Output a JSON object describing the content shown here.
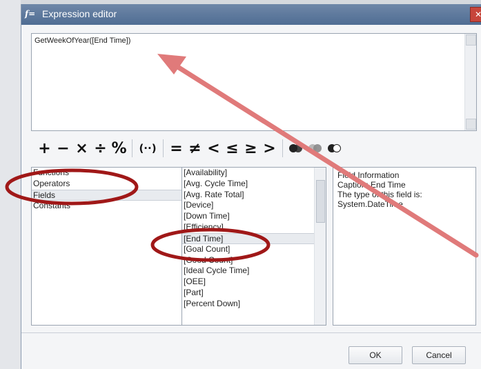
{
  "window": {
    "title": "Expression editor",
    "title_icon_glyph": "f=",
    "close_glyph": "✕"
  },
  "expression": {
    "value": "GetWeekOfYear([End Time])"
  },
  "operators": [
    "+",
    "−",
    "×",
    "÷",
    "%",
    "(··)",
    "=",
    "≠",
    "<",
    "≤",
    "≥",
    ">"
  ],
  "categories": {
    "items": [
      "Functions",
      "Operators",
      "Fields",
      "Constants"
    ],
    "selected": "Fields"
  },
  "fields": {
    "items": [
      "[Availability]",
      "[Avg. Cycle Time]",
      "[Avg. Rate Total]",
      "[Device]",
      "[Down Time]",
      "[Efficiency]",
      "[End Time]",
      "[Goal Count]",
      "[Good Count]",
      "[Ideal Cycle Time]",
      "[OEE]",
      "[Part]",
      "[Percent Down]"
    ],
    "selected": "[End Time]"
  },
  "info": {
    "heading": "Field Information",
    "caption": "Caption: End Time",
    "type_line": "The type of this field is:",
    "type_value": "System.DateTime"
  },
  "buttons": {
    "ok": "OK",
    "cancel": "Cancel"
  },
  "annotation_colors": {
    "arrow": "#e07a7a",
    "ellipse": "#a01818"
  }
}
